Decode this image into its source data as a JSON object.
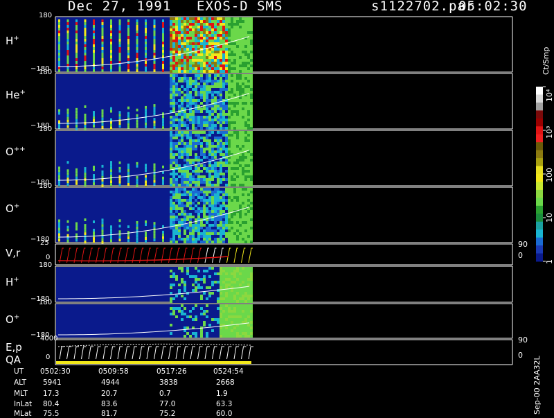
{
  "header": {
    "date": "Dec 27, 1991",
    "instrument": "EXOS-D SMS",
    "file": "s1122702.par",
    "time": "05:02:30"
  },
  "colors": {
    "background": "#000000",
    "low": "#0a1a8c",
    "cyan": "#19b4d2",
    "green": "#6bd84a",
    "yellow": "#f2e81a",
    "olive": "#8c7a10",
    "red": "#e01414",
    "dark_red": "#7a0a0a",
    "white": "#ffffff"
  },
  "chart_data": {
    "type": "heatmap",
    "panels": [
      {
        "label": "H",
        "charge": "+",
        "y_top": "180",
        "y_bottom": "−180",
        "kind": "spectrogram",
        "variant": "angle"
      },
      {
        "label": "He",
        "charge": "+",
        "y_top": "180",
        "y_bottom": "−180",
        "kind": "spectrogram",
        "variant": "angle"
      },
      {
        "label": "O",
        "charge": "++",
        "y_top": "180",
        "y_bottom": "−180",
        "kind": "spectrogram",
        "variant": "angle"
      },
      {
        "label": "O",
        "charge": "+",
        "y_top": "180",
        "y_bottom": "−180",
        "kind": "spectrogram",
        "variant": "angle"
      },
      {
        "label": "V,r",
        "charge": "",
        "y_top": "25",
        "y_bottom": "0",
        "right_top": "90",
        "right_bottom": "0",
        "kind": "line"
      },
      {
        "label": "H",
        "charge": "+",
        "y_top": "180",
        "y_bottom": "−180",
        "kind": "spectrogram",
        "variant": "energy"
      },
      {
        "label": "O",
        "charge": "+",
        "y_top": "180",
        "y_bottom": "−180",
        "kind": "spectrogram",
        "variant": "energy"
      },
      {
        "label": "E,p",
        "label2": "QA",
        "charge": "",
        "y_top": "4000",
        "y_bottom": "0",
        "right_top": "90",
        "right_bottom": "0",
        "kind": "line"
      }
    ],
    "colorbar": {
      "title": "Ct/Smp",
      "ticks": [
        "10⁴",
        "10³",
        "100",
        "10",
        "1"
      ],
      "tick_fracs": [
        0.0,
        0.25,
        0.5,
        0.75,
        1.0
      ],
      "colors": [
        "#ffffff",
        "#d9d9d9",
        "#a0a0a0",
        "#7a0a0a",
        "#9a0000",
        "#e01414",
        "#f02020",
        "#6a5a08",
        "#8c7a10",
        "#a8a010",
        "#e8e020",
        "#f2e81a",
        "#c8e830",
        "#8cd840",
        "#6bd84a",
        "#2aa030",
        "#1a8c3c",
        "#1aa0a0",
        "#19b4d2",
        "#1a6ad2",
        "#1a3ab4",
        "#0a1a8c"
      ]
    },
    "ephemeris": {
      "labels": [
        "UT",
        "ALT",
        "MLT",
        "InLat",
        "MLat"
      ],
      "times": [
        "0502:30",
        "0509:58",
        "0517:26",
        "0524:54"
      ],
      "rows": [
        [
          "5941",
          "4944",
          "3838",
          "2668"
        ],
        [
          "17.3",
          "20.7",
          "0.7",
          "1.9"
        ],
        [
          "80.4",
          "83.6",
          "77.0",
          "63.3"
        ],
        [
          "75.5",
          "81.7",
          "75.2",
          "60.0"
        ]
      ]
    },
    "footer_right": "Sep-00 2AA32L"
  }
}
